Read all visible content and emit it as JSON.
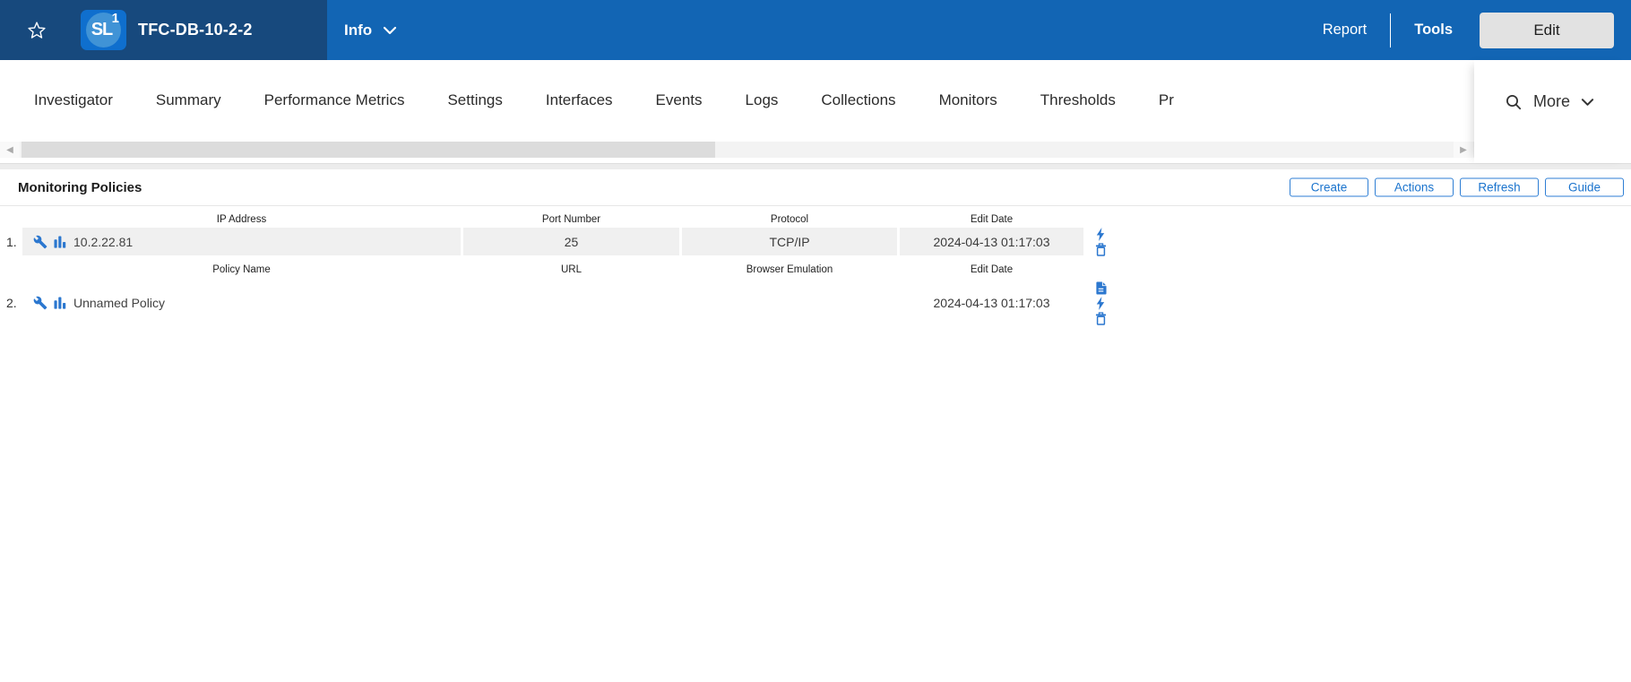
{
  "topbar": {
    "device_name": "TFC-DB-10-2-2",
    "logo_text": "SL",
    "logo_superscript": "1",
    "info_label": "Info",
    "report_label": "Report",
    "tools_label": "Tools",
    "edit_label": "Edit"
  },
  "tabs": {
    "items": [
      {
        "label": "Investigator",
        "active": false
      },
      {
        "label": "Summary",
        "active": false
      },
      {
        "label": "Performance Metrics",
        "active": false
      },
      {
        "label": "Settings",
        "active": false
      },
      {
        "label": "Interfaces",
        "active": false
      },
      {
        "label": "Events",
        "active": false
      },
      {
        "label": "Logs",
        "active": false
      },
      {
        "label": "Collections",
        "active": false
      },
      {
        "label": "Monitors",
        "active": true
      },
      {
        "label": "Thresholds",
        "active": false
      },
      {
        "label": "Pr",
        "active": false,
        "truncated": true
      }
    ],
    "more_label": "More",
    "icons": [
      "search-icon",
      "chevron-down-icon"
    ]
  },
  "content": {
    "title": "Monitoring Policies",
    "buttons": {
      "create": "Create",
      "actions": "Actions",
      "refresh": "Refresh",
      "guide": "Guide"
    },
    "table": {
      "groups": [
        {
          "headers": [
            "IP Address",
            "Port Number",
            "Protocol",
            "Edit Date"
          ],
          "row": {
            "index": "1.",
            "icons_left": [
              "wrench-icon",
              "bar-chart-icon"
            ],
            "name": "10.2.22.81",
            "port_number": "25",
            "protocol": "TCP/IP",
            "edit_date": "2024-04-13 01:17:03",
            "icons_right": [
              "lightning-icon",
              "trash-icon"
            ],
            "shaded": true
          }
        },
        {
          "headers": [
            "Policy Name",
            "URL",
            "Browser Emulation",
            "Edit Date"
          ],
          "row": {
            "index": "2.",
            "icons_left": [
              "wrench-icon",
              "bar-chart-icon"
            ],
            "name": "Unnamed Policy",
            "url": "",
            "browser_emulation": "",
            "edit_date": "2024-04-13 01:17:03",
            "icons_right": [
              "document-icon",
              "lightning-icon",
              "trash-icon"
            ],
            "shaded": false
          }
        }
      ]
    }
  },
  "colors": {
    "topbar_left_bg": "#17497D",
    "topbar_right_bg": "#1265B4",
    "logo_tile_bg": "#0F6FCE",
    "logo_circle_bg": "#4093D6",
    "active_tab_underline": "#1976D2",
    "accent_blue": "#1a73cd",
    "icon_blue": "#2b77cf",
    "shaded_row_bg": "#F0F0F0",
    "edit_button_bg": "#E2E2E2"
  }
}
